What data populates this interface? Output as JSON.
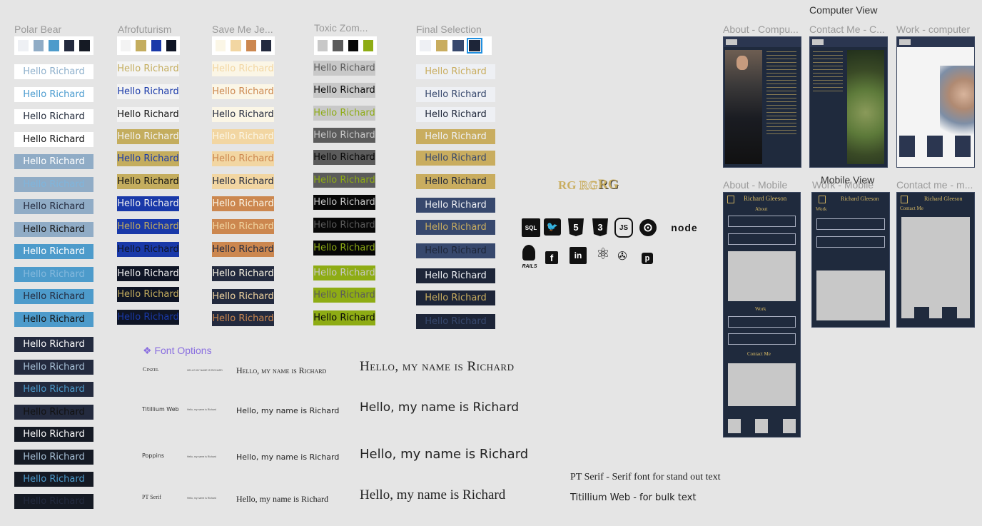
{
  "hello_text": "Hello Richard",
  "palettes": [
    {
      "title": "Polar Bear",
      "swatches": [
        "#eef0f4",
        "#90acc6",
        "#4d9bcb",
        "#232a3e",
        "#151a24"
      ]
    },
    {
      "title": "Afrofuturism",
      "swatches": [
        "#f3f3f3",
        "#c4ad5e",
        "#1939a9",
        "#0f1525"
      ]
    },
    {
      "title": "Save Me Je...",
      "swatches": [
        "#fbf6e6",
        "#f2d6a2",
        "#cc874f",
        "#232a3e"
      ]
    },
    {
      "title": "Toxic Zom...",
      "swatches": [
        "#c8c8c8",
        "#5b5b5b",
        "#070707",
        "#8eac14"
      ]
    },
    {
      "title": "Final Selection",
      "swatches": [
        "#eef0f4",
        "#c9ad5f",
        "#37486d",
        "#1d2538"
      ]
    }
  ],
  "hello_columns": [
    [
      {
        "bg": "#ffffff",
        "fg": "#8eb0cc"
      },
      {
        "bg": "#ffffff",
        "fg": "#4a9bcf"
      },
      {
        "bg": "#ffffff",
        "fg": "#222a3a"
      },
      {
        "bg": "#ffffff",
        "fg": "#111111"
      },
      {
        "bg": "#90acc6",
        "fg": "#ffffff"
      },
      {
        "bg": "#90acc6",
        "fg": "#7fb5dc"
      },
      {
        "bg": "#90acc6",
        "fg": "#232a3e"
      },
      {
        "bg": "#90acc6",
        "fg": "#111111"
      },
      {
        "bg": "#4d9bcb",
        "fg": "#ffffff"
      },
      {
        "bg": "#4d9bcb",
        "fg": "#85b9dd"
      },
      {
        "bg": "#4d9bcb",
        "fg": "#232a3e"
      },
      {
        "bg": "#4d9bcb",
        "fg": "#111111"
      },
      {
        "bg": "#232a3e",
        "fg": "#ffffff"
      },
      {
        "bg": "#232a3e",
        "fg": "#a9c2d8"
      },
      {
        "bg": "#232a3e",
        "fg": "#4d9bcb"
      },
      {
        "bg": "#232a3e",
        "fg": "#111111"
      },
      {
        "bg": "#151a24",
        "fg": "#ffffff"
      },
      {
        "bg": "#151a24",
        "fg": "#a9c2d8"
      },
      {
        "bg": "#151a24",
        "fg": "#4d9bcb"
      },
      {
        "bg": "#151a24",
        "fg": "#232a3e"
      }
    ],
    [
      {
        "bg": "#f3f3f3",
        "fg": "#c4ad5e"
      },
      {
        "bg": "#f3f3f3",
        "fg": "#1939a9"
      },
      {
        "bg": "#f3f3f3",
        "fg": "#111111"
      },
      {
        "bg": "#c4ad5e",
        "fg": "#f3f3f3"
      },
      {
        "bg": "#c4ad5e",
        "fg": "#1939a9"
      },
      {
        "bg": "#c4ad5e",
        "fg": "#111111"
      },
      {
        "bg": "#1939a9",
        "fg": "#f3f3f3"
      },
      {
        "bg": "#1939a9",
        "fg": "#c4ad5e"
      },
      {
        "bg": "#1939a9",
        "fg": "#0f1525"
      },
      {
        "bg": "#0f1525",
        "fg": "#f3f3f3"
      },
      {
        "bg": "#0f1525",
        "fg": "#c4ad5e"
      },
      {
        "bg": "#0f1525",
        "fg": "#1939a9"
      }
    ],
    [
      {
        "bg": "#fbf6e6",
        "fg": "#f2d6a2"
      },
      {
        "bg": "#fbf6e6",
        "fg": "#cc874f"
      },
      {
        "bg": "#fbf6e6",
        "fg": "#232a3e"
      },
      {
        "bg": "#f2d6a2",
        "fg": "#fbf6e6"
      },
      {
        "bg": "#f2d6a2",
        "fg": "#cc874f"
      },
      {
        "bg": "#f2d6a2",
        "fg": "#232a3e"
      },
      {
        "bg": "#cc874f",
        "fg": "#fbf6e6"
      },
      {
        "bg": "#cc874f",
        "fg": "#f2d6a2"
      },
      {
        "bg": "#cc874f",
        "fg": "#232a3e"
      },
      {
        "bg": "#232a3e",
        "fg": "#fbf6e6"
      },
      {
        "bg": "#232a3e",
        "fg": "#f2d6a2"
      },
      {
        "bg": "#232a3e",
        "fg": "#cc874f"
      }
    ],
    [
      {
        "bg": "#c8c8c8",
        "fg": "#5b5b5b"
      },
      {
        "bg": "#c8c8c8",
        "fg": "#070707"
      },
      {
        "bg": "#c8c8c8",
        "fg": "#8eac14"
      },
      {
        "bg": "#5b5b5b",
        "fg": "#c8c8c8"
      },
      {
        "bg": "#5b5b5b",
        "fg": "#070707"
      },
      {
        "bg": "#5b5b5b",
        "fg": "#8eac14"
      },
      {
        "bg": "#070707",
        "fg": "#c8c8c8"
      },
      {
        "bg": "#070707",
        "fg": "#5b5b5b"
      },
      {
        "bg": "#070707",
        "fg": "#8eac14"
      },
      {
        "bg": "#8eac14",
        "fg": "#c8c8c8"
      },
      {
        "bg": "#8eac14",
        "fg": "#5b5b5b"
      },
      {
        "bg": "#8eac14",
        "fg": "#070707"
      }
    ],
    [
      {
        "bg": "#eef0f4",
        "fg": "#c9ad5f"
      },
      {
        "bg": "#eef0f4",
        "fg": "#37486d"
      },
      {
        "bg": "#eef0f4",
        "fg": "#1d2538"
      },
      {
        "bg": "#c9ad5f",
        "fg": "#eef0f4"
      },
      {
        "bg": "#c9ad5f",
        "fg": "#37486d"
      },
      {
        "bg": "#c9ad5f",
        "fg": "#1d2538"
      },
      {
        "bg": "#37486d",
        "fg": "#eef0f4"
      },
      {
        "bg": "#37486d",
        "fg": "#c9ad5f"
      },
      {
        "bg": "#37486d",
        "fg": "#1d2538"
      },
      {
        "bg": "#1d2538",
        "fg": "#eef0f4"
      },
      {
        "bg": "#1d2538",
        "fg": "#c9ad5f"
      },
      {
        "bg": "#1d2538",
        "fg": "#37486d"
      }
    ]
  ],
  "font_options": {
    "header": "❖ Font Options",
    "rows": [
      {
        "name": "Cinzel",
        "tiny": "HELLO MY NAME IS RICHARD",
        "medium": "Hello, my name is Richard",
        "large": "Hello, my name is Richard"
      },
      {
        "name": "Titillium Web",
        "tiny": "Hello, my name is Richard",
        "medium": "Hello, my name is Richard",
        "large": "Hello, my name is Richard"
      },
      {
        "name": "Poppins",
        "tiny": "Hello, my name is Richard",
        "medium": "Hello, my name is Richard",
        "large": "Hello, my name is Richard"
      },
      {
        "name": "PT Serif",
        "tiny": "Hello, my name is Richard",
        "medium": "Hello, my name is Richard",
        "large": "Hello, my name is Richard"
      }
    ],
    "notes": [
      "PT Serif - Serif font for stand out text",
      "Titillium Web - for bulk text"
    ]
  },
  "logos": [
    "RG",
    "RG",
    "RG"
  ],
  "tech_icons": [
    {
      "name": "sql-icon",
      "glyph": "SQL"
    },
    {
      "name": "twitter-icon",
      "glyph": "🐦"
    },
    {
      "name": "html5-icon",
      "glyph": "5"
    },
    {
      "name": "css3-icon",
      "glyph": "3"
    },
    {
      "name": "nodejs-hex-icon",
      "glyph": "JS"
    },
    {
      "name": "github-icon",
      "glyph": "⊙"
    },
    {
      "name": "node-logo-icon",
      "glyph": "node"
    },
    {
      "name": "rails-icon",
      "glyph": "RAILS"
    },
    {
      "name": "facebook-icon",
      "glyph": "f"
    },
    {
      "name": "linkedin-icon",
      "glyph": "in"
    },
    {
      "name": "react-icon",
      "glyph": "⚛"
    },
    {
      "name": "electron-icon",
      "glyph": "✇"
    },
    {
      "name": "pinterest-icon",
      "glyph": "p"
    }
  ],
  "mockups": {
    "computer_view_title": "Computer View",
    "mobile_view_title": "Mobile View",
    "computer_labels": [
      "About - Compu...",
      "Contact Me - C...",
      "Work - computer"
    ],
    "mobile_labels": [
      "About - Mobile",
      "Work - Mobile",
      "Contact me - m..."
    ],
    "brand": "Richard Gleeson",
    "nav_links": [
      "About",
      "Work",
      "Contact Me"
    ],
    "mobile_sections": [
      "About",
      "Work",
      "Contact Me"
    ],
    "work_mobile_section": "Work",
    "contact_mobile_section": "Contact Me"
  }
}
